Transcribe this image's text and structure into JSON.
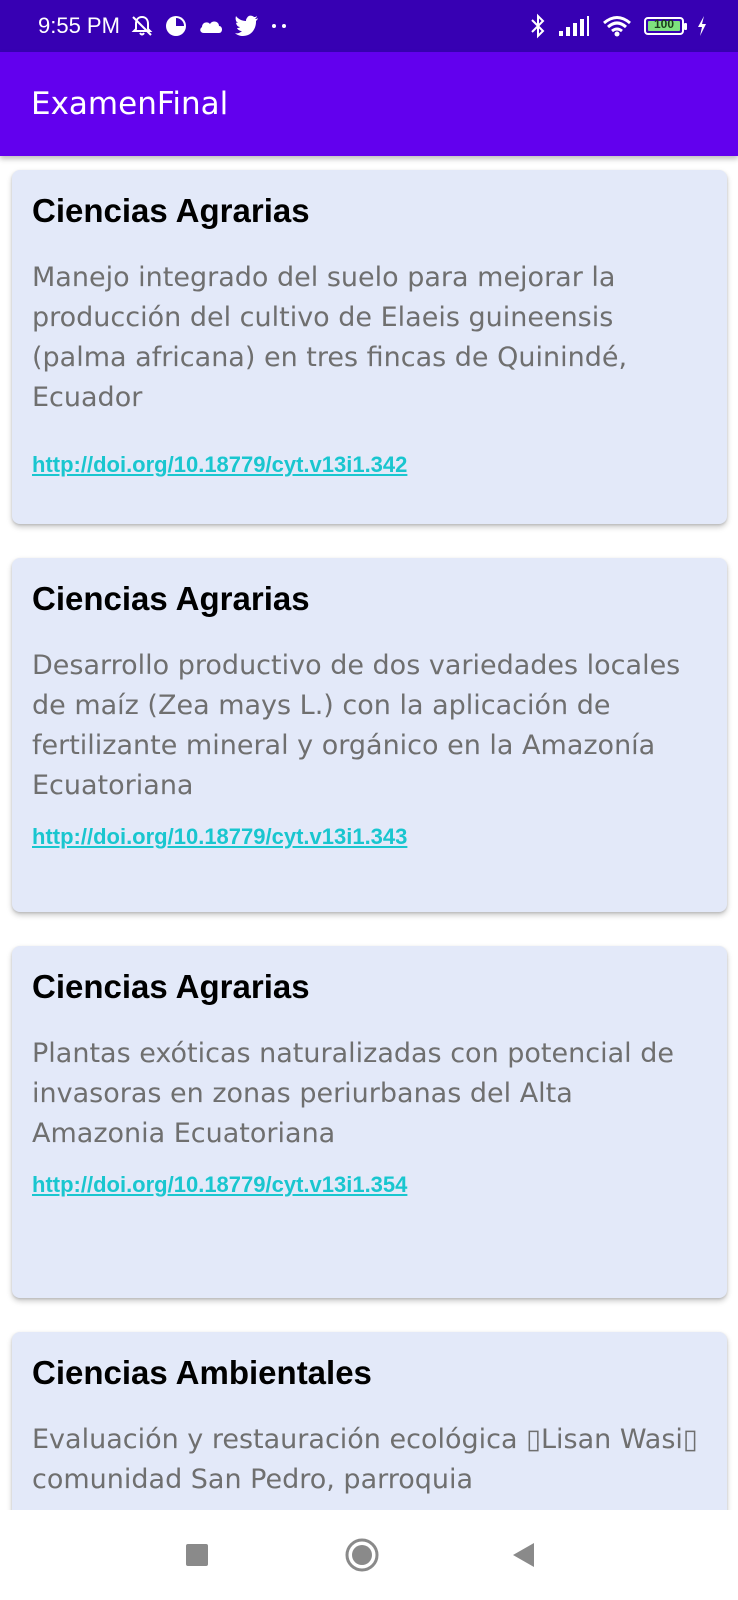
{
  "status_bar": {
    "time": "9:55 PM",
    "left_icons": [
      "bell-muted-icon",
      "circle-half-icon",
      "cloud-icon",
      "twitter-icon",
      "more-dots-icon"
    ],
    "right_icons": [
      "bluetooth-icon",
      "signal-icon",
      "wifi-icon",
      "battery-icon",
      "charging-bolt-icon"
    ],
    "battery_level": "100",
    "battery_fill_fraction": 1.0,
    "color": "#3700b3"
  },
  "app_bar": {
    "title": "ExamenFinal",
    "color": "#6200ee"
  },
  "cards": [
    {
      "category": "Ciencias Agrarias",
      "title": "Manejo integrado del suelo para mejorar la producción del cultivo de Elaeis guineensis (palma africana) en tres fincas de Quinindé, Ecuador",
      "link": "http://doi.org/10.18779/cyt.v13i1.342"
    },
    {
      "category": "Ciencias Agrarias",
      "title": "Desarrollo productivo de dos variedades locales de maíz (Zea mays L.) con la aplicación de fertilizante mineral y orgánico en la Amazonía Ecuatoriana",
      "link": "http://doi.org/10.18779/cyt.v13i1.343"
    },
    {
      "category": "Ciencias Agrarias",
      "title": "Plantas exóticas naturalizadas con potencial de invasoras en zonas periurbanas del Alta Amazonia Ecuatoriana",
      "link": "http://doi.org/10.18779/cyt.v13i1.354"
    },
    {
      "category": "Ciencias Ambientales",
      "title": "Evaluación y restauración ecológica ▯Lisan Wasi▯ comunidad San Pedro, parroquia",
      "link": ""
    }
  ],
  "colors": {
    "card_background": "#e3e9f9",
    "link": "#19c6cf",
    "title_text": "#6f6f6f"
  },
  "nav_bar": {
    "buttons": [
      "recents-square-icon",
      "home-circle-icon",
      "back-triangle-icon"
    ]
  }
}
